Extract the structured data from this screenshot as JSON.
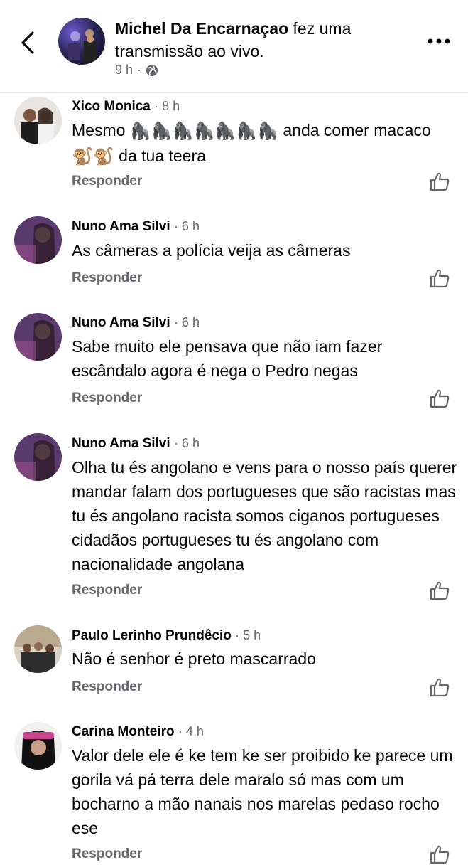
{
  "header": {
    "author": "Michel Da Encarnaçao",
    "action": " fez uma transmissão ao vivo.",
    "time": "9 h",
    "dot": "·",
    "privacy_icon": "globe-icon",
    "back_icon": "chevron-left-icon",
    "more_icon": "more-horizontal-icon"
  },
  "reply_label": "Responder",
  "comments": [
    {
      "author": "Xico Monica",
      "time": "· 8 h",
      "text_before": "Mesmo ",
      "gorillas": "🦍🦍🦍🦍🦍🦍🦍",
      "text_mid": " anda comer macaco ",
      "monkeys": "🐒🐒",
      "text_after": " da tua teera"
    },
    {
      "author": "Nuno Ama Silvi",
      "time": "· 6 h",
      "text": "As câmeras a polícia veija as câmeras"
    },
    {
      "author": "Nuno Ama Silvi",
      "time": "· 6 h",
      "text": "Sabe muito ele pensava que não iam fazer escândalo agora é  nega o Pedro negas"
    },
    {
      "author": "Nuno Ama Silvi",
      "time": "· 6 h",
      "text": "Olha tu és angolano e vens para o nosso  país querer mandar falam dos portugueses que são racistas mas tu és angolano racista somos ciganos portugueses cidadãos portugueses tu és angolano com nacionalidade angolana"
    },
    {
      "author": "Paulo Lerinho Prundêcio",
      "time": "· 5 h",
      "text": "Não é senhor é preto mascarrado"
    },
    {
      "author": "Carina Monteiro",
      "time": "· 4 h",
      "text": "Valor dele ele é ke tem ke ser proibido ke parece um gorila vá pá terra dele maralo só mas com um bocharno a mão nanais nos marelas pedaso rocho ese"
    }
  ],
  "colors": {
    "text": "#050505",
    "secondary": "#65676b",
    "divider": "#e4e6eb"
  }
}
